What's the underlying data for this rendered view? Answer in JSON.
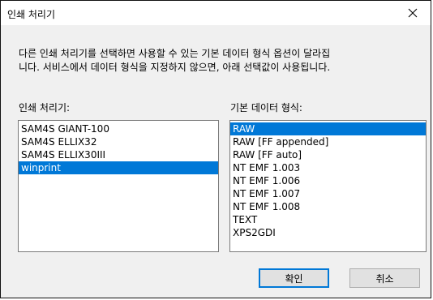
{
  "dialog": {
    "title": "인쇄 처리기",
    "description_line1": "다른 인쇄 처리기를 선택하면 사용할 수 있는 기본 데이터 형식 옵션이 달라집",
    "description_line2": "니다. 서비스에서 데이터 형식을 지정하지 않으면, 아래 선택값이 사용됩니다."
  },
  "printers": {
    "label": "인쇄 처리기:",
    "items": [
      {
        "label": "SAM4S GIANT-100"
      },
      {
        "label": "SAM4S ELLIX32"
      },
      {
        "label": "SAM4S ELLIX30III"
      },
      {
        "label": "winprint"
      }
    ],
    "selected": "winprint"
  },
  "formats": {
    "label": "기본 데이터 형식:",
    "items": [
      {
        "label": "RAW"
      },
      {
        "label": "RAW [FF appended]"
      },
      {
        "label": "RAW [FF auto]"
      },
      {
        "label": "NT EMF 1.003"
      },
      {
        "label": "NT EMF 1.006"
      },
      {
        "label": "NT EMF 1.007"
      },
      {
        "label": "NT EMF 1.008"
      },
      {
        "label": "TEXT"
      },
      {
        "label": "XPS2GDI"
      }
    ],
    "selected": "RAW"
  },
  "buttons": {
    "ok": "확인",
    "cancel": "취소"
  },
  "colors": {
    "selection": "#0078d7",
    "dialog_bg": "#f0f0f0"
  }
}
